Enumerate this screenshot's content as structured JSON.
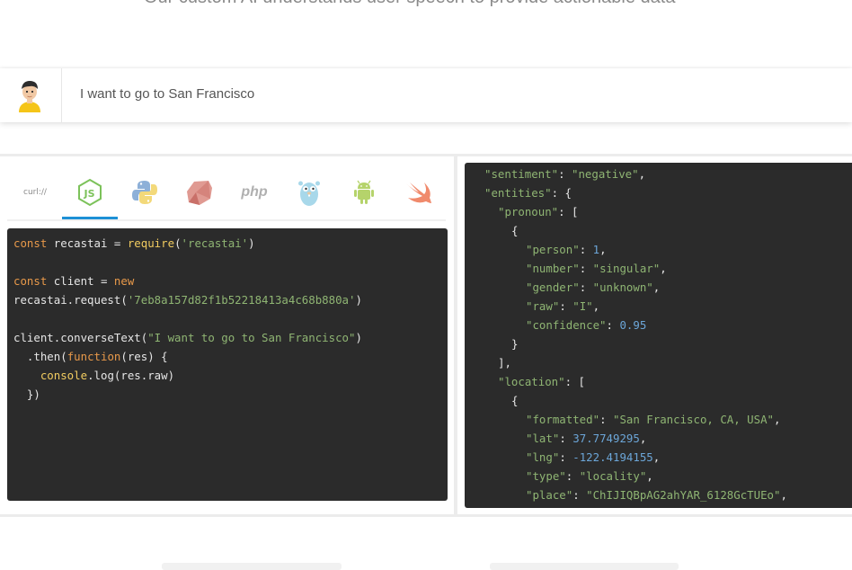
{
  "tagline": "Our custom AI understands user speech to provide actionable data",
  "sentence": {
    "text": "I want to go to San Francisco"
  },
  "languages": [
    {
      "name": "curl",
      "label": "curl://",
      "icon": "curl-icon",
      "active": false
    },
    {
      "name": "nodejs",
      "label": "",
      "icon": "nodejs-icon",
      "active": true
    },
    {
      "name": "python",
      "label": "",
      "icon": "python-icon",
      "active": false
    },
    {
      "name": "ruby",
      "label": "",
      "icon": "ruby-icon",
      "active": false
    },
    {
      "name": "php",
      "label": "php",
      "icon": "php-icon",
      "active": false
    },
    {
      "name": "go",
      "label": "",
      "icon": "go-gopher-icon",
      "active": false
    },
    {
      "name": "android",
      "label": "",
      "icon": "android-icon",
      "active": false
    },
    {
      "name": "swift",
      "label": "",
      "icon": "swift-icon",
      "active": false
    }
  ],
  "code": {
    "line1_kw": "const",
    "line1_var": " recastai = ",
    "line1_fn": "require",
    "line1_open": "(",
    "line1_str": "'recastai'",
    "line1_close": ")",
    "line3_kw": "const",
    "line3_var": " client = ",
    "line3_new": "new",
    "line4_call": "recastai.request(",
    "line4_str": "'7eb8a157d82f1b52218413a4c68b880a'",
    "line4_close": ")",
    "line6_call": "client.converseText(",
    "line6_str": "\"I want to go to San Francisco\"",
    "line6_close": ")",
    "line7_then": "  .then(",
    "line7_fn": "function",
    "line7_rest": "(res) {",
    "line8_console": "    console",
    "line8_rest": ".log(res.raw)",
    "line9": "  })"
  },
  "json_response": {
    "sentiment_key": "\"sentiment\"",
    "sentiment_val": "\"negative\"",
    "entities_key": "\"entities\"",
    "pronoun_key": "\"pronoun\"",
    "person_key": "\"person\"",
    "person_val": "1",
    "number_key": "\"number\"",
    "number_val": "\"singular\"",
    "gender_key": "\"gender\"",
    "gender_val": "\"unknown\"",
    "raw_key": "\"raw\"",
    "raw_val": "\"I\"",
    "confidence_key": "\"confidence\"",
    "confidence_val": "0.95",
    "location_key": "\"location\"",
    "formatted_key": "\"formatted\"",
    "formatted_val": "\"San Francisco, CA, USA\"",
    "lat_key": "\"lat\"",
    "lat_val": "37.7749295",
    "lng_key": "\"lng\"",
    "lng_val": "-122.4194155",
    "type_key": "\"type\"",
    "type_val": "\"locality\"",
    "place_key": "\"place\"",
    "place_val": "\"ChIJIQBpAG2ahYAR_6128GcTUEo\""
  },
  "colors": {
    "accent": "#1e90d6",
    "code_bg": "#2b2b2b",
    "keyword": "#e8994a",
    "function": "#f2cc60",
    "string": "#8fb573",
    "number": "#6ca6d8"
  }
}
